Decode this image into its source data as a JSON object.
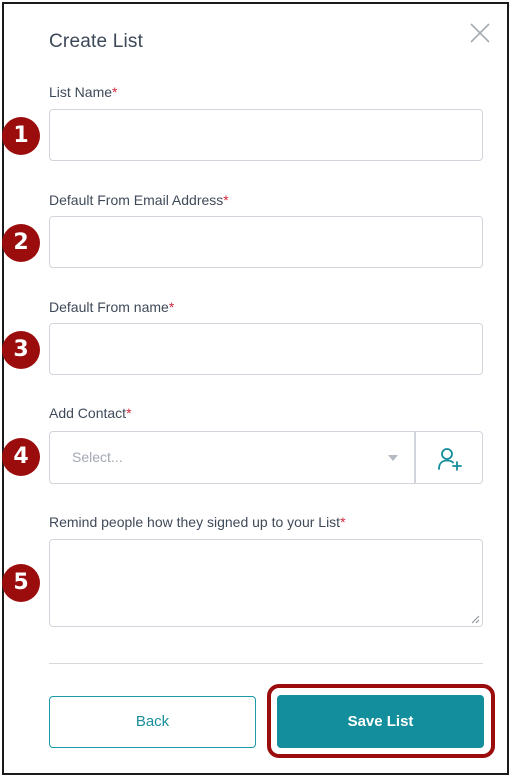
{
  "dialog": {
    "title": "Create List",
    "close_icon": "close-icon"
  },
  "fields": [
    {
      "number": "1",
      "label": "List Name",
      "required_mark": "*",
      "value": ""
    },
    {
      "number": "2",
      "label": "Default From Email Address",
      "required_mark": "*",
      "value": ""
    },
    {
      "number": "3",
      "label": "Default From name",
      "required_mark": "*",
      "value": ""
    }
  ],
  "contact": {
    "number": "4",
    "label": "Add Contact",
    "required_mark": "*",
    "placeholder": "Select...",
    "dropdown_icon": "caret-down-icon",
    "add_button_icon": "add-user-icon"
  },
  "reminder": {
    "number": "5",
    "label": "Remind people how they signed up to your List",
    "required_mark": "*",
    "value": ""
  },
  "footer": {
    "back_label": "Back",
    "save_label": "Save List"
  },
  "colors": {
    "accent": "#138e9c",
    "annotation": "#9b0c0c",
    "required": "#d0283c"
  }
}
